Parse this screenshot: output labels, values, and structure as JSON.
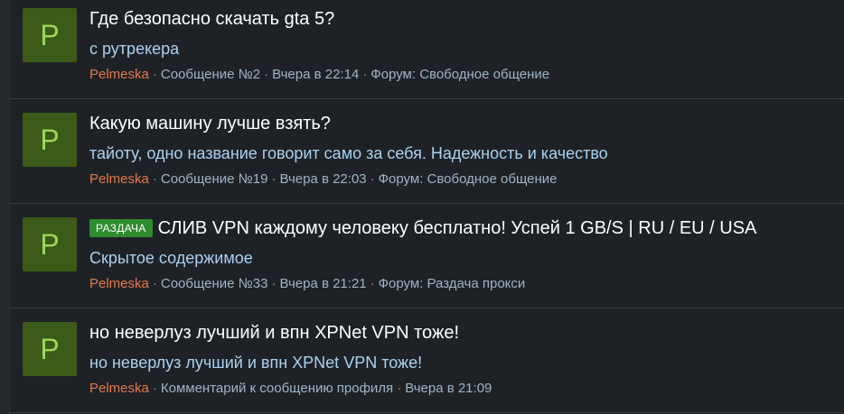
{
  "posts": [
    {
      "avatar_letter": "P",
      "title": "Где безопасно скачать gta 5?",
      "snippet": "с рутрекера",
      "author": "Pelmeska",
      "meta": [
        "Сообщение №2",
        "Вчера в 22:14",
        "Форум: Свободное общение"
      ]
    },
    {
      "avatar_letter": "P",
      "title": "Какую машину лучше взять?",
      "snippet": "тайоту, одно название говорит само за себя. Надежность и качество",
      "author": "Pelmeska",
      "meta": [
        "Сообщение №19",
        "Вчера в 22:03",
        "Форум: Свободное общение"
      ]
    },
    {
      "avatar_letter": "P",
      "badge": "РАЗДАЧА",
      "title": "СЛИВ VPN каждому человеку бесплатно! Успей 1 GB/S | RU / EU / USA",
      "snippet": "Скрытое содержимое",
      "author": "Pelmeska",
      "meta": [
        "Сообщение №33",
        "Вчера в 21:21",
        "Форум: Раздача прокси"
      ]
    },
    {
      "avatar_letter": "P",
      "title": "но неверлуз лучший и впн XPNet VPN тоже!",
      "snippet": "но неверлуз лучший и впн XPNet VPN тоже!",
      "author": "Pelmeska",
      "meta": [
        "Комментарий к сообщению профиля",
        "Вчера в 21:09"
      ]
    }
  ],
  "separator": "·",
  "colors": {
    "background": "#1e2226",
    "avatar_bg": "#3c5a18",
    "avatar_letter": "#9bd85a",
    "title": "#ffffff",
    "snippet": "#aad1f0",
    "author": "#e6784a",
    "meta": "#9fb4c6",
    "badge_bg": "#2e8b2e"
  }
}
